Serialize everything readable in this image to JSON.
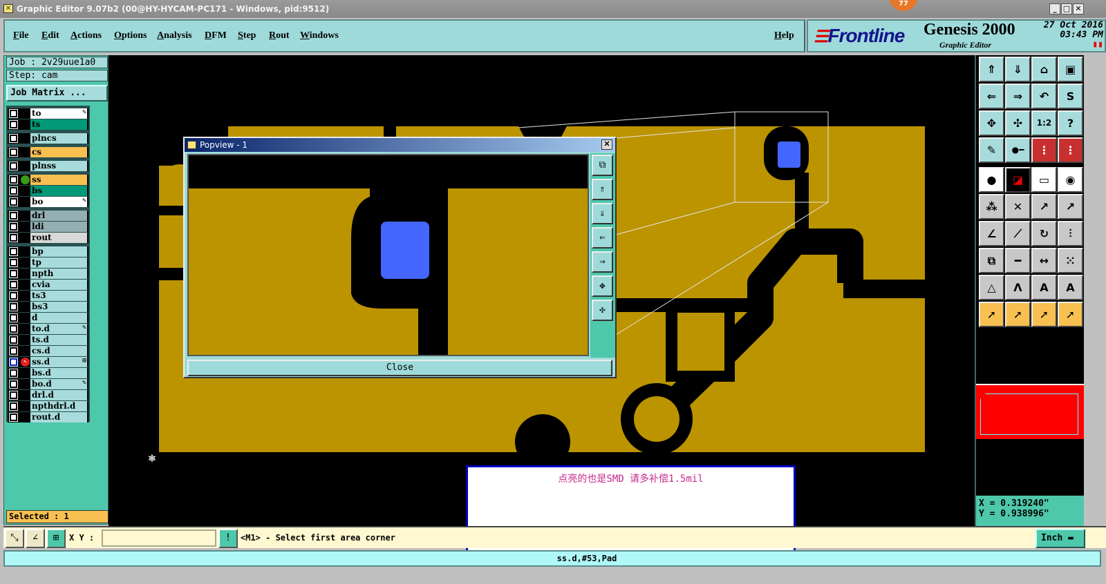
{
  "window": {
    "title": "Graphic Editor 9.07b2 (00@HY-HYCAM-PC171 - Windows, pid:9512)",
    "badge": "77",
    "minimize": "_",
    "maximize": "□",
    "close": "✕"
  },
  "menu": [
    "File",
    "Edit",
    "Actions",
    "Options",
    "Analysis",
    "DFM",
    "Step",
    "Rout",
    "Windows"
  ],
  "help": "Help",
  "brand": {
    "logo": "Frontline",
    "product": "Genesis 2000",
    "subtitle": "Graphic Editor",
    "date": "27 Oct 2016",
    "time": "03:43 PM"
  },
  "job": {
    "job": "Job : 2v29uue1a0",
    "step": "Step: cam",
    "matrix_button": "Job Matrix ..."
  },
  "layers": [
    {
      "name": "to",
      "color": "#ffffff",
      "marker": "✎"
    },
    {
      "name": "ts",
      "color": "#009a78"
    },
    {
      "name": "plncs",
      "color": "#a8dcdc"
    },
    {
      "name": "cs",
      "color": "#f8c050"
    },
    {
      "name": "plnss",
      "color": "#a8dcdc"
    },
    {
      "name": "ss",
      "color": "#f8c050",
      "work": true
    },
    {
      "name": "bs",
      "color": "#009a78"
    },
    {
      "name": "bo",
      "color": "#ffffff",
      "marker": "✎"
    },
    {
      "name": "drl",
      "color": "#94aeb4"
    },
    {
      "name": "ldi",
      "color": "#94aeb4"
    },
    {
      "name": "rout",
      "color": "#d8d8d8"
    },
    {
      "name": "bp",
      "color": "#a8dcdc"
    },
    {
      "name": "tp",
      "color": "#a8dcdc"
    },
    {
      "name": "npth",
      "color": "#a8dcdc"
    },
    {
      "name": "cvia",
      "color": "#a8dcdc"
    },
    {
      "name": "ts3",
      "color": "#a8dcdc"
    },
    {
      "name": "bs3",
      "color": "#a8dcdc"
    },
    {
      "name": "d",
      "color": "#a8dcdc"
    },
    {
      "name": "to.d",
      "color": "#a8dcdc",
      "marker": "✎"
    },
    {
      "name": "ts.d",
      "color": "#a8dcdc"
    },
    {
      "name": "cs.d",
      "color": "#a8dcdc"
    },
    {
      "name": "ss.d",
      "color": "#a8dcdc",
      "marker": "⊞",
      "affected": true
    },
    {
      "name": "bs.d",
      "color": "#a8dcdc"
    },
    {
      "name": "bo.d",
      "color": "#a8dcdc",
      "marker": "✎"
    },
    {
      "name": "drl.d",
      "color": "#a8dcdc"
    },
    {
      "name": "npthdrl.d",
      "color": "#a8dcdc"
    },
    {
      "name": "rout.d",
      "color": "#a8dcdc"
    }
  ],
  "selected": "Selected : 1",
  "popview": {
    "title": "Popview - 1",
    "close": "Close",
    "buttons": [
      "zoom-fit-icon",
      "pan-up-icon",
      "pan-down-icon",
      "pan-left-icon",
      "pan-right-icon",
      "zoom-out-icon",
      "zoom-in-icon"
    ]
  },
  "note": "点亮的也是SMD  请多补偿1.5mil",
  "toolbar": [
    {
      "icon": "pan-up-icon",
      "g": "⇑",
      "bg": "#a8dcdc"
    },
    {
      "icon": "pan-down-icon",
      "g": "⇓",
      "bg": "#a8dcdc"
    },
    {
      "icon": "home-icon",
      "g": "⌂",
      "bg": "#a8dcdc"
    },
    {
      "icon": "zoom-window-icon",
      "g": "▣",
      "bg": "#a8dcdc"
    },
    {
      "icon": "pan-left-icon",
      "g": "⇐",
      "bg": "#a8dcdc"
    },
    {
      "icon": "pan-right-icon",
      "g": "⇒",
      "bg": "#a8dcdc"
    },
    {
      "icon": "undo-zoom-icon",
      "g": "↶",
      "bg": "#a8dcdc"
    },
    {
      "icon": "snap-icon",
      "g": "S",
      "bg": "#a8dcdc"
    },
    {
      "icon": "zoom-out-icon",
      "g": "✥",
      "bg": "#a8dcdc"
    },
    {
      "icon": "zoom-in-icon",
      "g": "✣",
      "bg": "#a8dcdc"
    },
    {
      "icon": "scale-1-2-icon",
      "g": "1:2",
      "bg": "#a8dcdc"
    },
    {
      "icon": "help-icon",
      "g": "?",
      "bg": "#a8dcdc"
    },
    {
      "icon": "tools-icon",
      "g": "✎",
      "bg": "#a8dcdc"
    },
    {
      "icon": "pad-line-icon",
      "g": "●━",
      "bg": "#a8dcdc"
    },
    {
      "icon": "netlist-icon",
      "g": "⋮",
      "bg": "#c83030"
    },
    {
      "icon": "netlist-2-icon",
      "g": "⋮",
      "bg": "#c83030"
    },
    {
      "icon": "add-pad-icon",
      "g": "●",
      "bg": "#ffffff"
    },
    {
      "icon": "window-select-icon",
      "g": "◪",
      "bg": "#000000"
    },
    {
      "icon": "ruler-icon",
      "g": "▭",
      "bg": "#ffffff"
    },
    {
      "icon": "pad-dash-icon",
      "g": "◉",
      "bg": "#ffffff"
    },
    {
      "icon": "connect-icon",
      "g": "⁂",
      "bg": "#c8c8c8"
    },
    {
      "icon": "delete-icon",
      "g": "✕",
      "bg": "#c8c8c8"
    },
    {
      "icon": "move-pad-icon",
      "g": "↗",
      "bg": "#c8c8c8"
    },
    {
      "icon": "move-pad-2-icon",
      "g": "↗",
      "bg": "#c8c8c8"
    },
    {
      "icon": "line-angle-icon",
      "g": "∠",
      "bg": "#c8c8c8"
    },
    {
      "icon": "line-move-icon",
      "g": "⟋",
      "bg": "#c8c8c8"
    },
    {
      "icon": "rotate-icon",
      "g": "↻",
      "bg": "#c8c8c8"
    },
    {
      "icon": "mirror-icon",
      "g": "⫶",
      "bg": "#c8c8c8"
    },
    {
      "icon": "move-square-icon",
      "g": "⧉",
      "bg": "#c8c8c8"
    },
    {
      "icon": "line-split-icon",
      "g": "━",
      "bg": "#c8c8c8"
    },
    {
      "icon": "measure-icon",
      "g": "↔",
      "bg": "#c8c8c8"
    },
    {
      "icon": "cluster-icon",
      "g": "⁙",
      "bg": "#c8c8c8"
    },
    {
      "icon": "triangle-icon",
      "g": "△",
      "bg": "#c8c8c8"
    },
    {
      "icon": "arc-icon",
      "g": "Λ",
      "bg": "#c8c8c8"
    },
    {
      "icon": "arc-2-icon",
      "g": "A",
      "bg": "#c8c8c8"
    },
    {
      "icon": "arc-3-icon",
      "g": "A",
      "bg": "#c8c8c8"
    },
    {
      "icon": "select-icon",
      "g": "➚",
      "bg": "#f8c050"
    },
    {
      "icon": "select-box-icon",
      "g": "➚",
      "bg": "#f8c050"
    },
    {
      "icon": "select-polygon-icon",
      "g": "➚",
      "bg": "#f8c050"
    },
    {
      "icon": "select-net-icon",
      "g": "➚",
      "bg": "#f8c050"
    }
  ],
  "coords": {
    "x": "X = 0.319240\"",
    "y": "Y = 0.938996\""
  },
  "bottom": {
    "xy_label": "X Y :",
    "xy_value": "",
    "prompt": "<M1> - Select first area corner",
    "units": "Inch"
  },
  "status": "ss.d,#53,Pad"
}
